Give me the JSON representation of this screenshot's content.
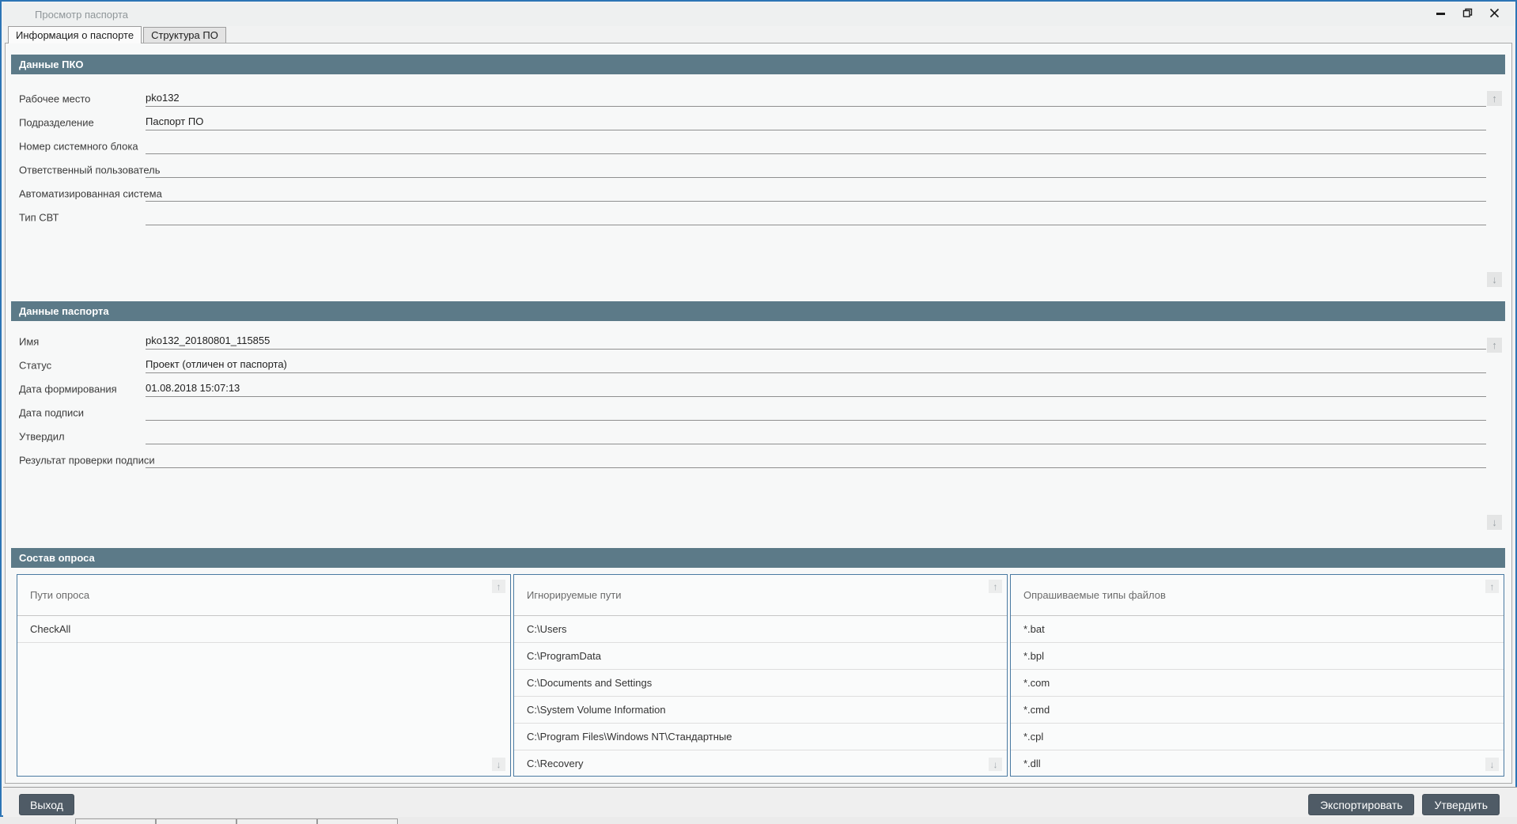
{
  "window": {
    "title": "Просмотр паспорта"
  },
  "tabs": [
    {
      "label": "Информация о паспорте",
      "active": true
    },
    {
      "label": "Структура ПО",
      "active": false
    }
  ],
  "sections": {
    "pko": {
      "title": "Данные ПКО",
      "fields": [
        {
          "label": "Рабочее место",
          "value": "pko132"
        },
        {
          "label": "Подразделение",
          "value": "Паспорт ПО"
        },
        {
          "label": "Номер системного блока",
          "value": ""
        },
        {
          "label": "Ответственный пользователь",
          "value": ""
        },
        {
          "label": "Автоматизированная система",
          "value": ""
        },
        {
          "label": "Тип СВТ",
          "value": ""
        }
      ]
    },
    "passport": {
      "title": "Данные паспорта",
      "fields": [
        {
          "label": "Имя",
          "value": "pko132_20180801_115855"
        },
        {
          "label": "Статус",
          "value": "Проект (отличен от паспорта)"
        },
        {
          "label": "Дата формирования",
          "value": "01.08.2018 15:07:13"
        },
        {
          "label": "Дата подписи",
          "value": ""
        },
        {
          "label": "Утвердил",
          "value": ""
        },
        {
          "label": "Результат проверки подписи",
          "value": ""
        }
      ]
    },
    "survey": {
      "title": "Состав опроса",
      "panels": [
        {
          "header": "Пути опроса",
          "items": [
            "CheckAll"
          ]
        },
        {
          "header": "Игнорируемые пути",
          "items": [
            "C:\\Users",
            "C:\\ProgramData",
            "C:\\Documents and Settings",
            "C:\\System Volume Information",
            "C:\\Program Files\\Windows NT\\Стандартные",
            "C:\\Recovery"
          ]
        },
        {
          "header": "Опрашиваемые типы файлов",
          "items": [
            "*.bat",
            "*.bpl",
            "*.com",
            "*.cmd",
            "*.cpl",
            "*.dll"
          ]
        }
      ]
    }
  },
  "buttons": {
    "exit": "Выход",
    "export": "Экспортировать",
    "approve": "Утвердить"
  },
  "icons": {
    "scroll_up": "↑",
    "scroll_down": "↓"
  },
  "colors": {
    "section_header_bg": "#5c7a88",
    "window_border": "#2d75b5",
    "panel_border": "#4a7aa2",
    "button_bg": "#4f5b66"
  }
}
